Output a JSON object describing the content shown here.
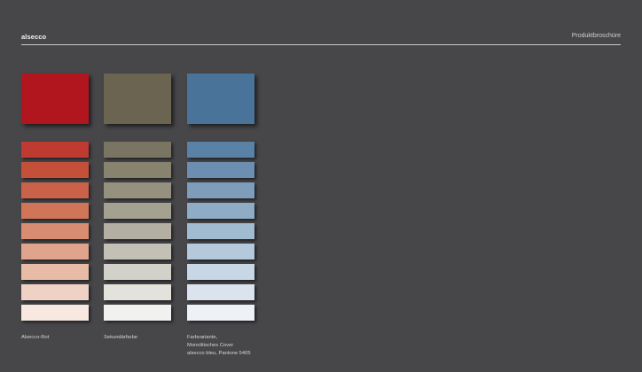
{
  "header": {
    "brand": "alsecco",
    "doc_title": "Produktbroschüre"
  },
  "columns": [
    {
      "name": "Alsecco-Rot",
      "caption": "Alsecco-Rot",
      "main_color": "#b1161e",
      "tints": [
        "#bf3a30",
        "#c4503a",
        "#c96248",
        "#d17558",
        "#d88d72",
        "#e0a38c",
        "#e8bba7",
        "#f0d2c5",
        "#f8e8e0"
      ]
    },
    {
      "name": "Sekundärfarbe",
      "caption": "Sekundärfarbe",
      "main_color": "#6a6451",
      "tints": [
        "#7a7563",
        "#88836f",
        "#96917f",
        "#a5a191",
        "#b3b0a3",
        "#c3c1b6",
        "#d3d2ca",
        "#e3e2dd",
        "#f1f1ef"
      ]
    },
    {
      "name": "Farbvariante",
      "caption": "Farbvariante,\nMonolitisches Cover\nalsecco bleu, Pantone 5405",
      "main_color": "#4a7399",
      "tints": [
        "#5a81a6",
        "#6c8fb1",
        "#7d9dbb",
        "#8eacc6",
        "#a1bbd1",
        "#b4c9db",
        "#c8d7e5",
        "#dbe4ee",
        "#eef2f7"
      ]
    }
  ]
}
